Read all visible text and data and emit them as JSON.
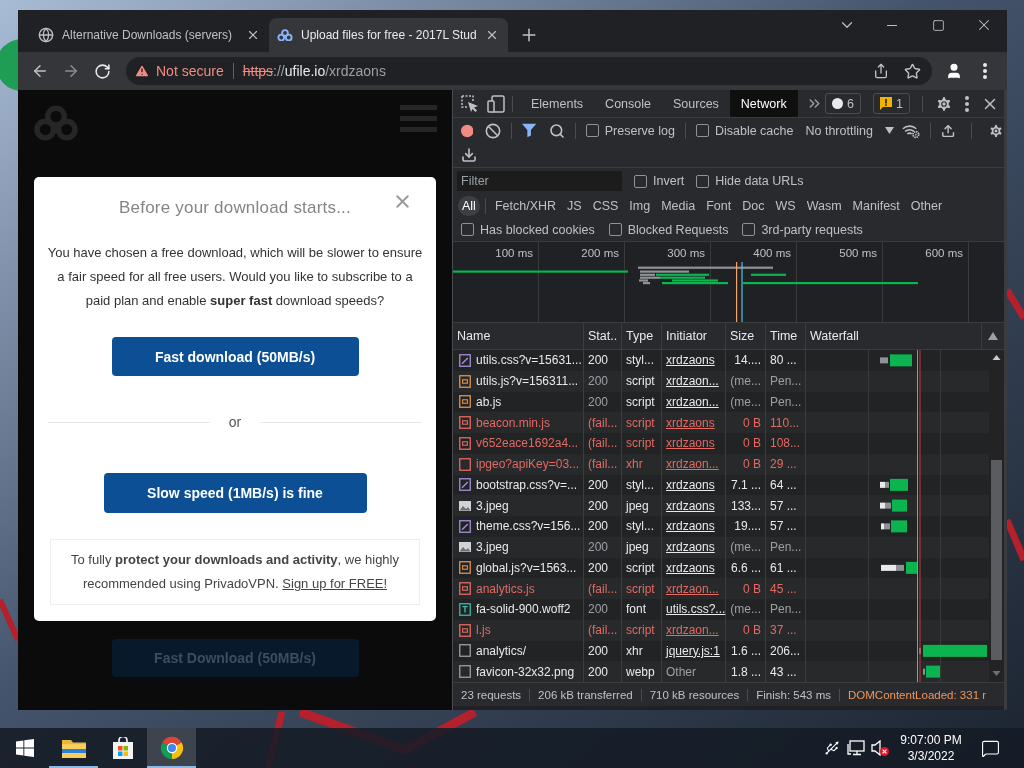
{
  "browser": {
    "tabs": [
      {
        "title": "Alternative Downloads (servers)",
        "kind": "globe",
        "selected": false
      },
      {
        "title": "Upload files for free - 2017L Stud",
        "kind": "cloud",
        "selected": true
      }
    ],
    "address": {
      "security": "Not secure",
      "scheme": "https",
      "separator": "://",
      "host": "ufile.io",
      "path": "/xrdzaons"
    }
  },
  "page": {
    "modal": {
      "title": "Before your download starts...",
      "message": "You have chosen a free download, which will be slower to ensure a fair speed for all free users. Would you like to subscribe to a paid plan and enable **super fast** download speeds?",
      "fast_button": "Fast download (50MB/s)",
      "divider": "or",
      "slow_button": "Slow speed (1MB/s) is fine",
      "notice": "To fully **protect your downloads and activity**, we highly recommended using PrivadoVPN.",
      "notice_link": "Sign up for FREE!"
    },
    "background_button": "Fast Download (50MB/s)"
  },
  "devtools": {
    "panel_tabs": [
      {
        "label": "Elements",
        "selected": false
      },
      {
        "label": "Console",
        "selected": false
      },
      {
        "label": "Sources",
        "selected": false
      },
      {
        "label": "Network",
        "selected": true
      }
    ],
    "counters": [
      {
        "kind": "info",
        "count": "6"
      },
      {
        "kind": "warning",
        "count": "1"
      }
    ],
    "toolbar": {
      "recording": true,
      "preserve_log": {
        "label": "Preserve log",
        "checked": false
      },
      "disable_cache": {
        "label": "Disable cache",
        "checked": false
      },
      "throttling": "No throttling"
    },
    "filter": {
      "placeholder": "Filter",
      "options": [
        {
          "label": "Invert",
          "checked": false
        },
        {
          "label": "Hide data URLs",
          "checked": false
        }
      ]
    },
    "type_filters": [
      {
        "label": "All",
        "selected": true
      },
      {
        "label": "Fetch/XHR",
        "selected": false
      },
      {
        "label": "JS",
        "selected": false
      },
      {
        "label": "CSS",
        "selected": false
      },
      {
        "label": "Img",
        "selected": false
      },
      {
        "label": "Media",
        "selected": false
      },
      {
        "label": "Font",
        "selected": false
      },
      {
        "label": "Doc",
        "selected": false
      },
      {
        "label": "WS",
        "selected": false
      },
      {
        "label": "Wasm",
        "selected": false
      },
      {
        "label": "Manifest",
        "selected": false
      },
      {
        "label": "Other",
        "selected": false
      }
    ],
    "request_filters": [
      {
        "label": "Has blocked cookies",
        "checked": false
      },
      {
        "label": "Blocked Requests",
        "checked": false
      },
      {
        "label": "3rd-party requests",
        "checked": false
      }
    ],
    "overview": {
      "ticks": [
        "100 ms",
        "200 ms",
        "300 ms",
        "400 ms",
        "500 ms",
        "600 ms"
      ]
    },
    "table": {
      "columns": [
        "Name",
        "Stat..",
        "Type",
        "Initiator",
        "Size",
        "Time",
        "Waterfall"
      ],
      "rows": [
        {
          "name": "utils.css?v=15631...",
          "kind": "stylesheet",
          "status": "200",
          "type": "styl...",
          "initiator": "xrdzaons",
          "initiator_link": true,
          "size": "14....",
          "time": "80 ...",
          "failed": false,
          "pending": false
        },
        {
          "name": "utils.js?v=156311...",
          "kind": "script",
          "status": "200",
          "type": "script",
          "initiator": "xrdzaon...",
          "initiator_link": true,
          "size": "(me...",
          "time": "Pen...",
          "failed": false,
          "pending": true
        },
        {
          "name": "ab.js",
          "kind": "script",
          "status": "200",
          "type": "script",
          "initiator": "xrdzaon...",
          "initiator_link": true,
          "size": "(me...",
          "time": "Pen...",
          "failed": false,
          "pending": true
        },
        {
          "name": "beacon.min.js",
          "kind": "script",
          "status": "(fail...",
          "type": "script",
          "initiator": "xrdzaons",
          "initiator_link": true,
          "size": "0 B",
          "time": "110...",
          "failed": true,
          "pending": false
        },
        {
          "name": "v652eace1692a4...",
          "kind": "script",
          "status": "(fail...",
          "type": "script",
          "initiator": "xrdzaons",
          "initiator_link": true,
          "size": "0 B",
          "time": "108...",
          "failed": true,
          "pending": false
        },
        {
          "name": "ipgeo?apiKey=03...",
          "kind": "xhr",
          "status": "(fail...",
          "type": "xhr",
          "initiator": "xrdzaon...",
          "initiator_link": true,
          "size": "0 B",
          "time": "29 ...",
          "failed": true,
          "pending": false
        },
        {
          "name": "bootstrap.css?v=...",
          "kind": "stylesheet",
          "status": "200",
          "type": "styl...",
          "initiator": "xrdzaons",
          "initiator_link": true,
          "size": "7.1 ...",
          "time": "64 ...",
          "failed": false,
          "pending": false
        },
        {
          "name": "3.jpeg",
          "kind": "image",
          "status": "200",
          "type": "jpeg",
          "initiator": "xrdzaons",
          "initiator_link": true,
          "size": "133...",
          "time": "57 ...",
          "failed": false,
          "pending": false
        },
        {
          "name": "theme.css?v=156...",
          "kind": "stylesheet",
          "status": "200",
          "type": "styl...",
          "initiator": "xrdzaons",
          "initiator_link": true,
          "size": "19....",
          "time": "57 ...",
          "failed": false,
          "pending": false
        },
        {
          "name": "3.jpeg",
          "kind": "image",
          "status": "200",
          "type": "jpeg",
          "initiator": "xrdzaons",
          "initiator_link": true,
          "size": "(me...",
          "time": "Pen...",
          "failed": false,
          "pending": true
        },
        {
          "name": "global.js?v=1563...",
          "kind": "script",
          "status": "200",
          "type": "script",
          "initiator": "xrdzaons",
          "initiator_link": true,
          "size": "6.6 ...",
          "time": "61 ...",
          "failed": false,
          "pending": false
        },
        {
          "name": "analytics.js",
          "kind": "script",
          "status": "(fail...",
          "type": "script",
          "initiator": "xrdzaon...",
          "initiator_link": true,
          "size": "0 B",
          "time": "45 ...",
          "failed": true,
          "pending": false
        },
        {
          "name": "fa-solid-900.woff2",
          "kind": "font",
          "status": "200",
          "type": "font",
          "initiator": "utils.css?...",
          "initiator_link": true,
          "size": "(me...",
          "time": "Pen...",
          "failed": false,
          "pending": true
        },
        {
          "name": "l.js",
          "kind": "script",
          "status": "(fail...",
          "type": "script",
          "initiator": "xrdzaon...",
          "initiator_link": true,
          "size": "0 B",
          "time": "37 ...",
          "failed": true,
          "pending": false
        },
        {
          "name": "analytics/",
          "kind": "xhr",
          "status": "200",
          "type": "xhr",
          "initiator": "jquery.js:1",
          "initiator_link": true,
          "size": "1.6 ...",
          "time": "206...",
          "failed": false,
          "pending": false
        },
        {
          "name": "favicon-32x32.png",
          "kind": "other",
          "status": "200",
          "type": "webp",
          "initiator": "Other",
          "initiator_link": false,
          "size": "1.8 ...",
          "time": "43 ...",
          "failed": false,
          "pending": false
        }
      ]
    },
    "status_bar": {
      "stats": [
        "23 requests",
        "206 kB transferred",
        "710 kB resources",
        "Finish: 543 ms"
      ],
      "dom_content_loaded": "DOMContentLoaded: 331 r"
    }
  },
  "taskbar": {
    "apps": [
      {
        "kind": "start",
        "running": false,
        "selected": false
      },
      {
        "kind": "files",
        "running": true,
        "selected": false
      },
      {
        "kind": "store",
        "running": false,
        "selected": false
      },
      {
        "kind": "chrome",
        "running": true,
        "selected": true
      }
    ],
    "clock": {
      "time": "9:07:00 PM",
      "date": "3/3/2022"
    }
  }
}
